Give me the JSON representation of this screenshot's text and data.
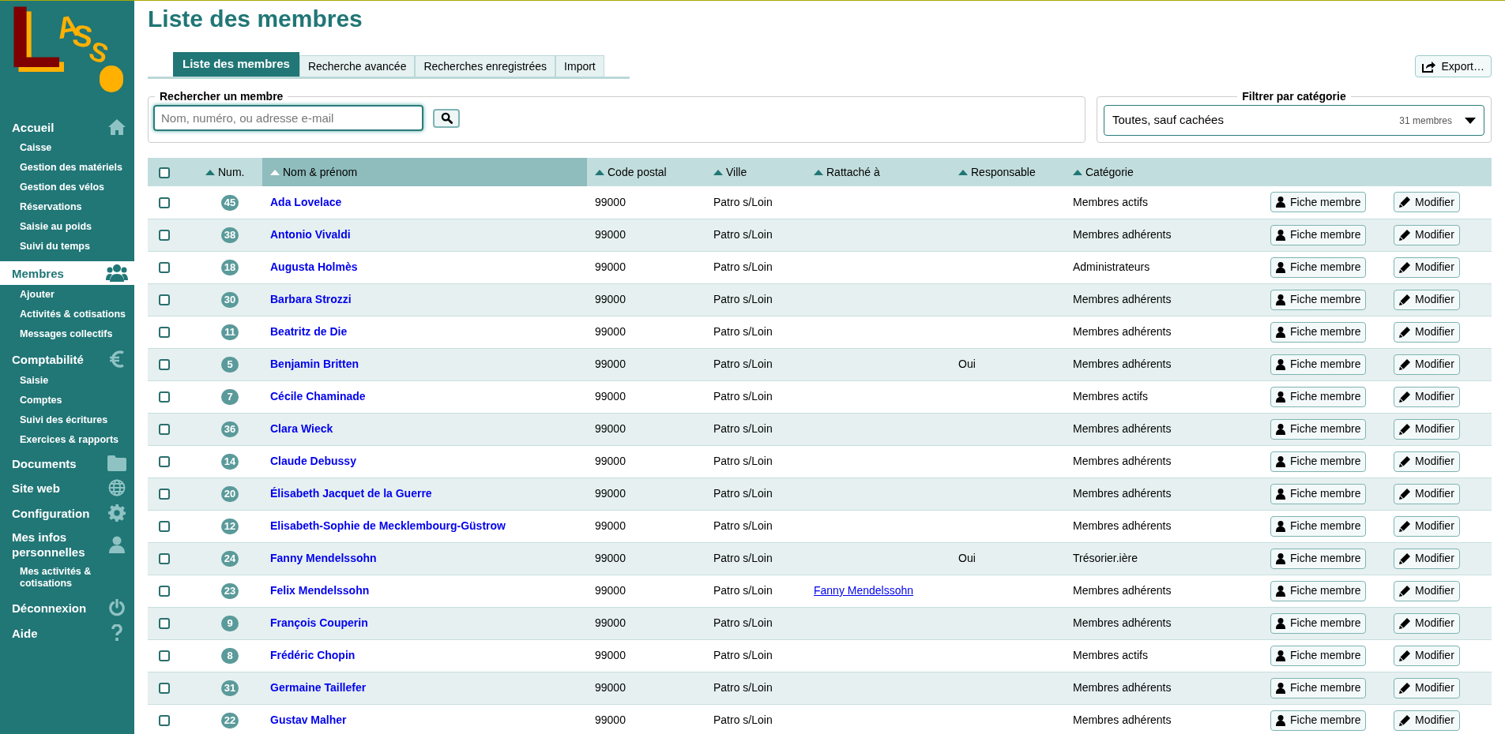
{
  "logo": "LASS",
  "sidebar": [
    {
      "label": "Accueil",
      "selected": false,
      "children": [
        {
          "label": "Caisse"
        },
        {
          "label": "Gestion des matériels"
        },
        {
          "label": "Gestion des vélos"
        },
        {
          "label": "Réservations"
        },
        {
          "label": "Saisie au poids"
        },
        {
          "label": "Suivi du temps"
        }
      ]
    },
    {
      "label": "Membres",
      "selected": true,
      "children": [
        {
          "label": "Ajouter"
        },
        {
          "label": "Activités & cotisations"
        },
        {
          "label": "Messages collectifs"
        }
      ]
    },
    {
      "label": "Comptabilité",
      "selected": false,
      "children": [
        {
          "label": "Saisie"
        },
        {
          "label": "Comptes"
        },
        {
          "label": "Suivi des écritures"
        },
        {
          "label": "Exercices & rapports"
        }
      ]
    },
    {
      "label": "Documents",
      "selected": false
    },
    {
      "label": "Site web",
      "selected": false
    },
    {
      "label": "Configuration",
      "selected": false
    },
    {
      "label": "Mes infos personnelles",
      "selected": false,
      "children": [
        {
          "label": "Mes activités & cotisations"
        }
      ]
    },
    {
      "label": "Déconnexion",
      "selected": false
    },
    {
      "label": "Aide",
      "selected": false
    }
  ],
  "title": "Liste des membres",
  "tabs": [
    {
      "label": "Liste des membres",
      "selected": true
    },
    {
      "label": "Recherche avancée",
      "selected": false
    },
    {
      "label": "Recherches enregistrées",
      "selected": false
    },
    {
      "label": "Import",
      "selected": false
    }
  ],
  "export_button": "Export…",
  "search": {
    "legend": "Rechercher un membre",
    "placeholder": "Nom, numéro, ou adresse e-mail"
  },
  "filter": {
    "legend": "Filtrer par catégorie",
    "value": "Toutes, sauf cachées",
    "count": "31 membres"
  },
  "table": {
    "select_all_checked": false,
    "columns": [
      {
        "label": "Num.",
        "sorted": false
      },
      {
        "label": "Nom & prénom",
        "sorted": true
      },
      {
        "label": "Code postal",
        "sorted": false
      },
      {
        "label": "Ville",
        "sorted": false
      },
      {
        "label": "Rattaché à",
        "sorted": false
      },
      {
        "label": "Responsable",
        "sorted": false
      },
      {
        "label": "Catégorie",
        "sorted": false
      }
    ],
    "rows": [
      {
        "checked": false,
        "num": "45",
        "name": "Ada Lovelace",
        "postal_code": "99000",
        "city": "Patro s/Loin",
        "category": "Membres actifs",
        "actions": [
          "Fiche membre",
          "Modifier"
        ]
      },
      {
        "checked": false,
        "num": "38",
        "name": "Antonio Vivaldi",
        "postal_code": "99000",
        "city": "Patro s/Loin",
        "category": "Membres adhérents",
        "actions": [
          "Fiche membre",
          "Modifier"
        ]
      },
      {
        "checked": false,
        "num": "18",
        "name": "Augusta Holmès",
        "postal_code": "99000",
        "city": "Patro s/Loin",
        "category": "Administrateurs",
        "actions": [
          "Fiche membre",
          "Modifier"
        ]
      },
      {
        "checked": false,
        "num": "30",
        "name": "Barbara Strozzi",
        "postal_code": "99000",
        "city": "Patro s/Loin",
        "category": "Membres adhérents",
        "actions": [
          "Fiche membre",
          "Modifier"
        ]
      },
      {
        "checked": false,
        "num": "11",
        "name": "Beatritz de Die",
        "postal_code": "99000",
        "city": "Patro s/Loin",
        "category": "Membres adhérents",
        "actions": [
          "Fiche membre",
          "Modifier"
        ]
      },
      {
        "checked": false,
        "num": "5",
        "name": "Benjamin Britten",
        "postal_code": "99000",
        "city": "Patro s/Loin",
        "responsible": "Oui",
        "category": "Membres adhérents",
        "actions": [
          "Fiche membre",
          "Modifier"
        ]
      },
      {
        "checked": false,
        "num": "7",
        "name": "Cécile Chaminade",
        "postal_code": "99000",
        "city": "Patro s/Loin",
        "category": "Membres actifs",
        "actions": [
          "Fiche membre",
          "Modifier"
        ]
      },
      {
        "checked": false,
        "num": "36",
        "name": "Clara Wieck",
        "postal_code": "99000",
        "city": "Patro s/Loin",
        "category": "Membres adhérents",
        "actions": [
          "Fiche membre",
          "Modifier"
        ]
      },
      {
        "checked": false,
        "num": "14",
        "name": "Claude Debussy",
        "postal_code": "99000",
        "city": "Patro s/Loin",
        "category": "Membres adhérents",
        "actions": [
          "Fiche membre",
          "Modifier"
        ]
      },
      {
        "checked": false,
        "num": "20",
        "name": "Élisabeth Jacquet de la Guerre",
        "postal_code": "99000",
        "city": "Patro s/Loin",
        "category": "Membres adhérents",
        "actions": [
          "Fiche membre",
          "Modifier"
        ]
      },
      {
        "checked": false,
        "num": "12",
        "name": "Elisabeth-Sophie de Mecklembourg-Güstrow",
        "postal_code": "99000",
        "city": "Patro s/Loin",
        "category": "Membres adhérents",
        "actions": [
          "Fiche membre",
          "Modifier"
        ]
      },
      {
        "checked": false,
        "num": "24",
        "name": "Fanny Mendelssohn",
        "postal_code": "99000",
        "city": "Patro s/Loin",
        "responsible": "Oui",
        "category": "Trésorier.ière",
        "actions": [
          "Fiche membre",
          "Modifier"
        ]
      },
      {
        "checked": false,
        "num": "23",
        "name": "Felix Mendelssohn",
        "postal_code": "99000",
        "city": "Patro s/Loin",
        "attached_to": "Fanny Mendelssohn",
        "category": "Membres adhérents",
        "actions": [
          "Fiche membre",
          "Modifier"
        ]
      },
      {
        "checked": false,
        "num": "9",
        "name": "François Couperin",
        "postal_code": "99000",
        "city": "Patro s/Loin",
        "category": "Membres adhérents",
        "actions": [
          "Fiche membre",
          "Modifier"
        ]
      },
      {
        "checked": false,
        "num": "8",
        "name": "Frédéric Chopin",
        "postal_code": "99000",
        "city": "Patro s/Loin",
        "category": "Membres actifs",
        "actions": [
          "Fiche membre",
          "Modifier"
        ]
      },
      {
        "checked": false,
        "num": "31",
        "name": "Germaine Taillefer",
        "postal_code": "99000",
        "city": "Patro s/Loin",
        "category": "Membres adhérents",
        "actions": [
          "Fiche membre",
          "Modifier"
        ]
      },
      {
        "checked": false,
        "num": "22",
        "name": "Gustav Malher",
        "postal_code": "99000",
        "city": "Patro s/Loin",
        "category": "Membres adhérents",
        "actions": [
          "Fiche membre",
          "Modifier"
        ]
      }
    ]
  }
}
